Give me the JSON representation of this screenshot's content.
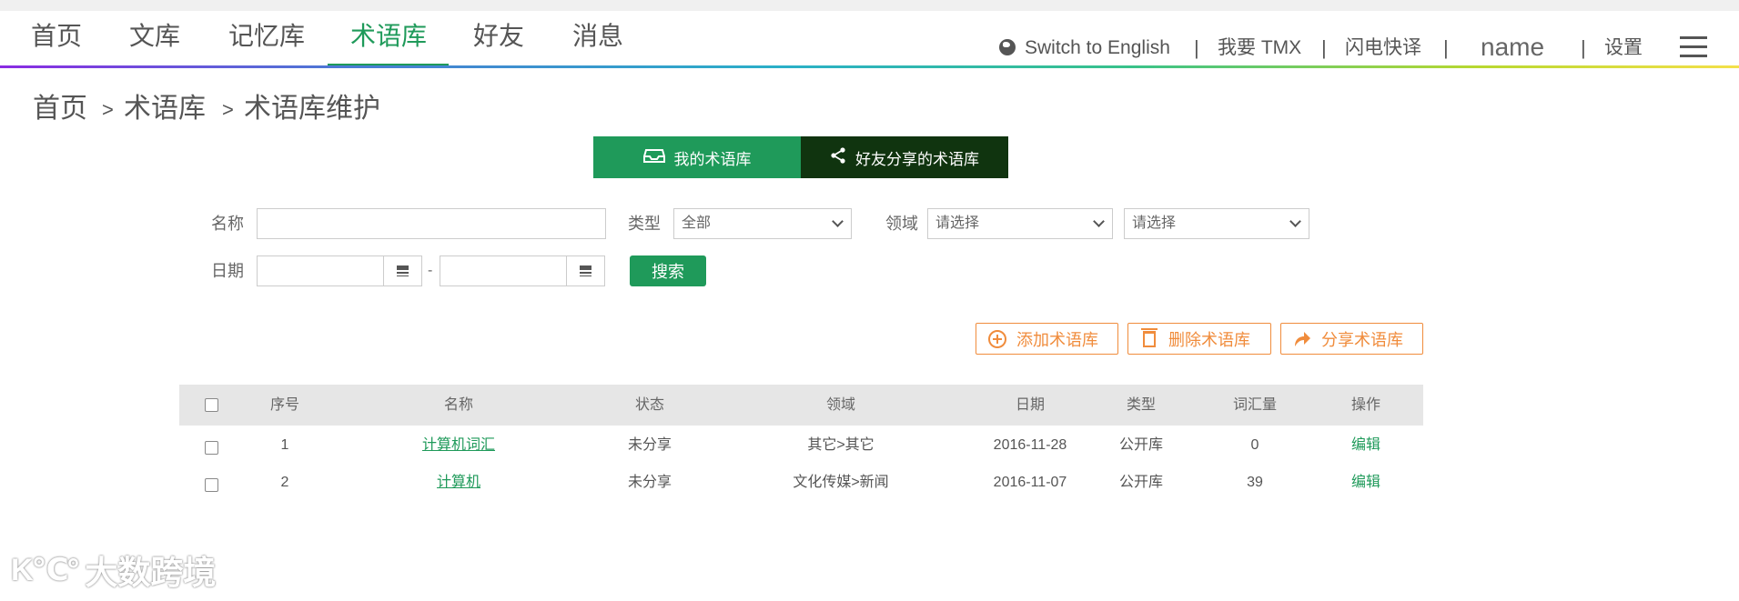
{
  "nav": {
    "items": [
      {
        "label": "首页"
      },
      {
        "label": "文库"
      },
      {
        "label": "记忆库"
      },
      {
        "label": "术语库"
      },
      {
        "label": "好友"
      },
      {
        "label": "消息"
      }
    ],
    "active_index": 3,
    "switch_language": "Switch to English",
    "want_tmx": "我要 TMX",
    "flash_translate": "闪电快译",
    "username": "name",
    "settings": "设置",
    "separator": "|"
  },
  "breadcrumb": {
    "items": [
      "首页",
      "术语库",
      "术语库维护"
    ],
    "separator": ">"
  },
  "tabs": {
    "mine": "我的术语库",
    "shared": "好友分享的术语库"
  },
  "search": {
    "name_label": "名称",
    "name_value": "",
    "type_label": "类型",
    "type_value": "全部",
    "domain_label": "领域",
    "domain_value_1": "请选择",
    "domain_value_2": "请选择",
    "date_label": "日期",
    "date_from": "",
    "date_to": "",
    "date_sep": "-",
    "search_button": "搜索"
  },
  "actions": {
    "add": "添加术语库",
    "delete": "删除术语库",
    "share": "分享术语库"
  },
  "table": {
    "columns": [
      "序号",
      "名称",
      "状态",
      "领域",
      "日期",
      "类型",
      "词汇量",
      "操作"
    ],
    "rows": [
      {
        "index": "1",
        "name": "计算机词汇",
        "status": "未分享",
        "domain": "其它>其它",
        "date": "2016-11-28",
        "type": "公开库",
        "count": "0",
        "op": "编辑"
      },
      {
        "index": "2",
        "name": "计算机",
        "status": "未分享",
        "domain": "文化传媒>新闻",
        "date": "2016-11-07",
        "type": "公开库",
        "count": "39",
        "op": "编辑"
      }
    ]
  },
  "watermark": {
    "logo": "K℃°",
    "text": "大数跨境"
  },
  "colors": {
    "accent_green": "#1f9a5a",
    "dark_green": "#10340f",
    "action_orange": "#f08c3c"
  }
}
